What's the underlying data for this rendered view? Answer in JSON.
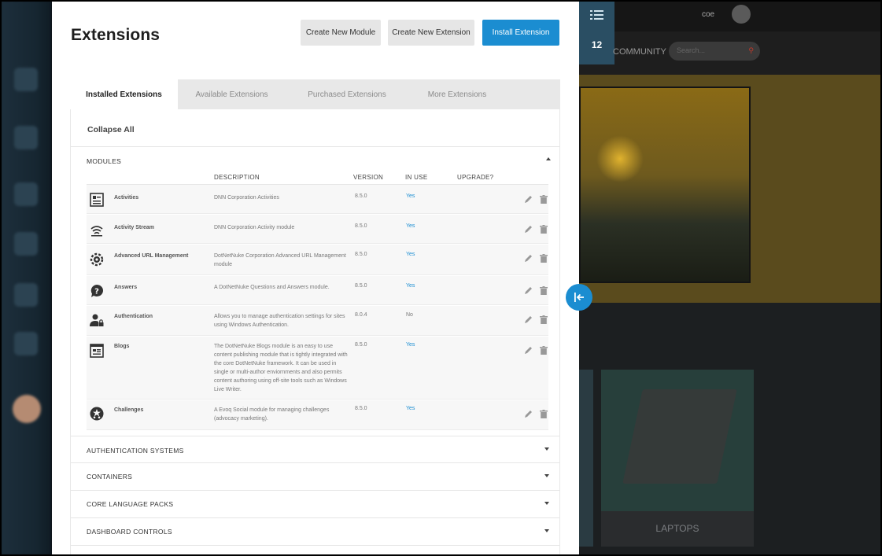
{
  "panel": {
    "title": "Extensions",
    "buttons": {
      "create_module": "Create New Module",
      "create_extension": "Create New Extension",
      "install_extension": "Install Extension"
    },
    "tabs": [
      "Installed Extensions",
      "Available Extensions",
      "Purchased Extensions",
      "More Extensions"
    ],
    "collapse_all": "Collapse All"
  },
  "modules": {
    "title": "MODULES",
    "columns": {
      "description": "DESCRIPTION",
      "version": "VERSION",
      "in_use": "IN USE",
      "upgrade": "UPGRADE?"
    },
    "rows": [
      {
        "name": "Activities",
        "description": "DNN Corporation Activities",
        "version": "8.5.0",
        "in_use": "Yes",
        "icon": "activities-icon"
      },
      {
        "name": "Activity Stream",
        "description": "DNN Corporation Activity module",
        "version": "8.5.0",
        "in_use": "Yes",
        "icon": "activity-stream-icon"
      },
      {
        "name": "Advanced URL Management",
        "description": "DotNetNuke Corporation Advanced URL Management module",
        "version": "8.5.0",
        "in_use": "Yes",
        "icon": "gear-globe-icon"
      },
      {
        "name": "Answers",
        "description": "A DotNetNuke Questions and Answers module.",
        "version": "8.5.0",
        "in_use": "Yes",
        "icon": "question-bubble-icon"
      },
      {
        "name": "Authentication",
        "description": "Allows you to manage authentication settings for sites using Windows Authentication.",
        "version": "8.0.4",
        "in_use": "No",
        "icon": "user-lock-icon"
      },
      {
        "name": "Blogs",
        "description": "The DotNetNuke Blogs module is an easy to use content publishing module that is tightly integrated with the core DotNetNuke framework. It can be used in single or multi-author enviornments and also permits content authoring using off-site tools such as Windows Live Writer.",
        "version": "8.5.0",
        "in_use": "Yes",
        "icon": "blog-icon"
      },
      {
        "name": "Challenges",
        "description": "A Evoq Social module for managing challenges (advocacy marketing).",
        "version": "8.5.0",
        "in_use": "Yes",
        "icon": "challenge-icon"
      }
    ]
  },
  "sections": [
    "AUTHENTICATION SYSTEMS",
    "CONTAINERS",
    "CORE LANGUAGE PACKS",
    "DASHBOARD CONTROLS"
  ],
  "site": {
    "badge_count": "12",
    "username": "coe",
    "nav_item": "COMMUNITY",
    "search_placeholder": "Search...",
    "tile_caption": "LAPTOPS"
  },
  "colors": {
    "accent": "#1b8dd1",
    "panel_bg": "#ffffff",
    "tab_bg": "#e8e8e8"
  }
}
